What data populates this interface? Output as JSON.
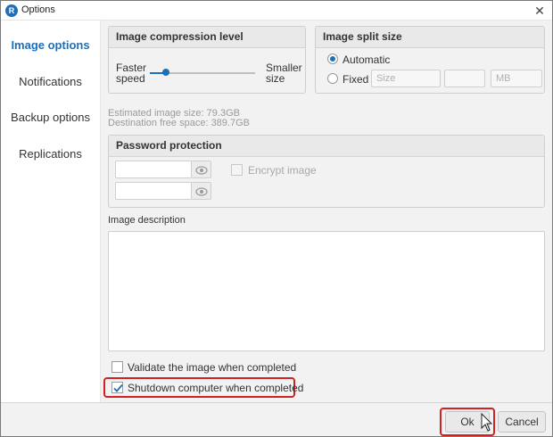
{
  "window": {
    "title": "Options",
    "app_icon_glyph": "R",
    "close_glyph": "✕"
  },
  "sidebar": {
    "items": [
      {
        "label": "Image options",
        "active": true
      },
      {
        "label": "Notifications",
        "active": false
      },
      {
        "label": "Backup options",
        "active": false
      },
      {
        "label": "Replications",
        "active": false
      }
    ]
  },
  "compression": {
    "title": "Image compression level",
    "left_label_1": "Faster",
    "left_label_2": "speed",
    "right_label_1": "Smaller",
    "right_label_2": "size",
    "level": 0.15
  },
  "split": {
    "title": "Image split size",
    "automatic_label": "Automatic",
    "fixed_label": "Fixed",
    "size_placeholder": "Size",
    "unit_placeholder": "MB",
    "selected": "Automatic"
  },
  "info": {
    "estimated": "Estimated image size: 79.3GB",
    "destination": "Destination free space: 389.7GB"
  },
  "password": {
    "title": "Password protection",
    "encrypt_label": "Encrypt image"
  },
  "description": {
    "label": "Image description",
    "value": ""
  },
  "options": {
    "validate_label": "Validate the image when completed",
    "validate_checked": false,
    "shutdown_label": "Shutdown computer when completed",
    "shutdown_checked": true
  },
  "footer": {
    "ok_label": "Ok",
    "cancel_label": "Cancel"
  },
  "colors": {
    "accent": "#1d6fb8",
    "highlight": "#d42020"
  }
}
